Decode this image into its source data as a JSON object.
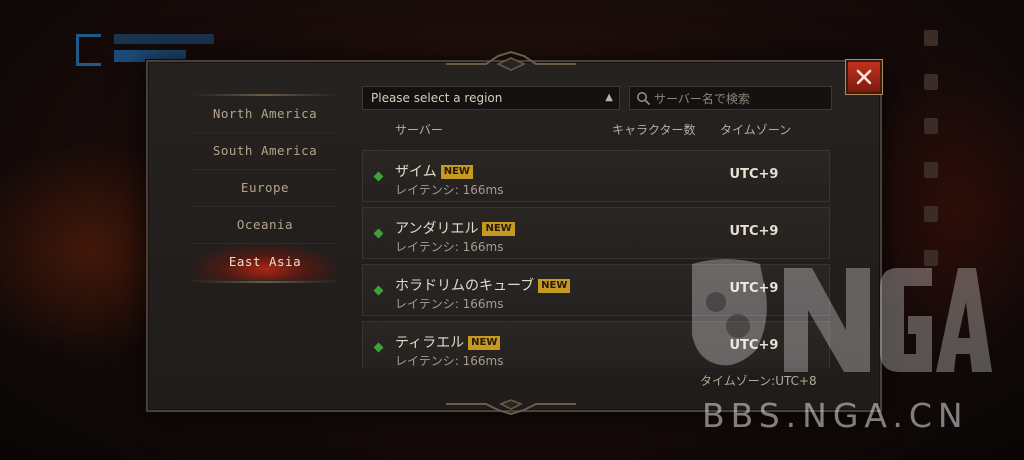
{
  "close_icon": "close-icon",
  "regions": {
    "items": [
      {
        "label": "North America",
        "active": false
      },
      {
        "label": "South America",
        "active": false
      },
      {
        "label": "Europe",
        "active": false
      },
      {
        "label": "Oceania",
        "active": false
      },
      {
        "label": "East Asia",
        "active": true
      }
    ]
  },
  "region_select": {
    "value": "Please select a region"
  },
  "search": {
    "placeholder": "サーバー名で検索",
    "value": ""
  },
  "columns": {
    "server": "サーバー",
    "characters": "キャラクター数",
    "timezone": "タイムゾーン"
  },
  "servers": [
    {
      "name": "ザイム",
      "badge": "NEW",
      "latency": "レイテンシ: 166ms",
      "timezone": "UTC+9"
    },
    {
      "name": "アンダリエル",
      "badge": "NEW",
      "latency": "レイテンシ: 166ms",
      "timezone": "UTC+9"
    },
    {
      "name": "ホラドリムのキューブ",
      "badge": "NEW",
      "latency": "レイテンシ: 166ms",
      "timezone": "UTC+9"
    },
    {
      "name": "ティラエル",
      "badge": "NEW",
      "latency": "レイテンシ: 166ms",
      "timezone": "UTC+9"
    }
  ],
  "footer": {
    "timezone_label": "タイムゾーン:UTC+8"
  },
  "watermark": {
    "logo": "NGA",
    "site": "BBS.NGA.CN"
  },
  "colors": {
    "status_online": "#3ea23a",
    "badge_new": "#c59a22",
    "close_button": "#c0311c"
  }
}
